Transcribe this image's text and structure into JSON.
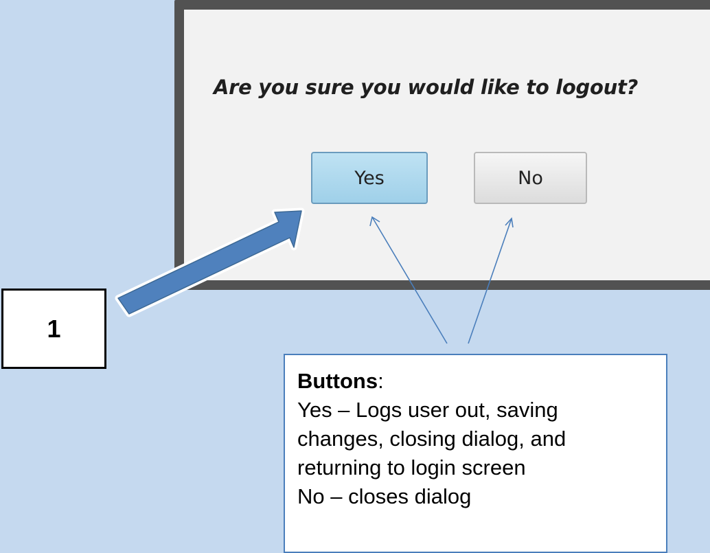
{
  "dialog": {
    "question": "Are you sure you would like to logout?",
    "buttons": {
      "yes": "Yes",
      "no": "No"
    }
  },
  "annotation": {
    "step_number": "1",
    "callout": {
      "title": "Buttons",
      "title_suffix": ":",
      "lines": [
        "Yes – Logs user out, saving",
        "changes, closing dialog, and",
        "returning to login screen",
        "No – closes dialog"
      ]
    }
  },
  "colors": {
    "background": "#c5d9ef",
    "dialog_frame": "#525252",
    "dialog_body": "#f2f2f2",
    "yes_button_fill": "#a9d6ec",
    "arrow_fill": "#4f81bd",
    "callout_border": "#4a7ebb"
  },
  "icons": {
    "pointer_arrow": "block-arrow-icon"
  }
}
